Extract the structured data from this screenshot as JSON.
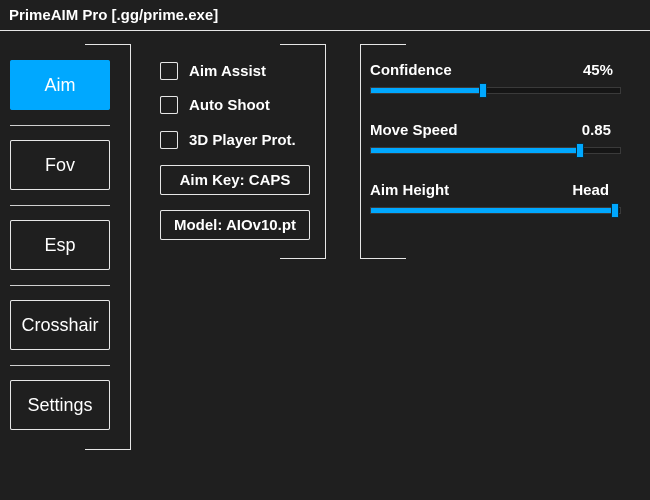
{
  "window": {
    "title": "PrimeAIM Pro [.gg/prime.exe]"
  },
  "colors": {
    "accent": "#00a8ff",
    "background": "#1f1f1f",
    "border": "#e6e6e6",
    "text": "#ffffff"
  },
  "nav": {
    "items": [
      {
        "label": "Aim",
        "active": true
      },
      {
        "label": "Fov",
        "active": false
      },
      {
        "label": "Esp",
        "active": false
      },
      {
        "label": "Crosshair",
        "active": false
      },
      {
        "label": "Settings",
        "active": false
      }
    ]
  },
  "options": {
    "checkboxes": [
      {
        "label": "Aim Assist",
        "checked": false
      },
      {
        "label": "Auto Shoot",
        "checked": false
      },
      {
        "label": "3D Player Prot.",
        "checked": false
      }
    ],
    "aim_key_label": "Aim Key: CAPS",
    "model_label": "Model: AIOv10.pt"
  },
  "sliders": [
    {
      "label": "Confidence",
      "value": "45%",
      "level": 0.45
    },
    {
      "label": "Move Speed",
      "value": "0.85",
      "level": 0.84
    },
    {
      "label": "Aim Height",
      "value": "Head",
      "level": 0.98
    }
  ]
}
